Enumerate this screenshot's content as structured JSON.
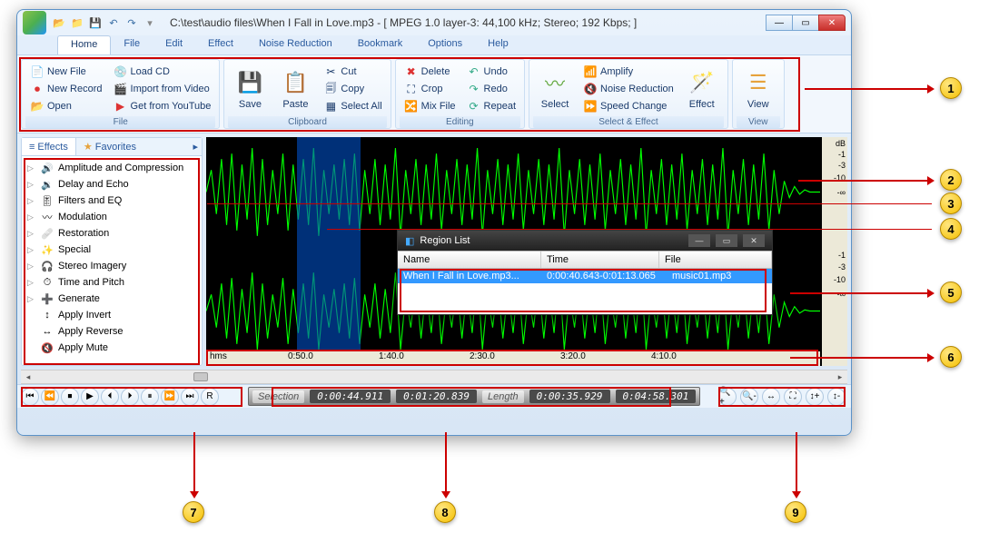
{
  "window": {
    "title": "C:\\test\\audio files\\When I Fall in Love.mp3 - [ MPEG 1.0 layer-3: 44,100 kHz; Stereo; 192 Kbps;  ]"
  },
  "menu": {
    "items": [
      "Home",
      "File",
      "Edit",
      "Effect",
      "Noise Reduction",
      "Bookmark",
      "Options",
      "Help"
    ],
    "active": 0
  },
  "ribbon": {
    "file": {
      "label": "File",
      "newfile": "New File",
      "newrecord": "New Record",
      "open": "Open",
      "loadcd": "Load CD",
      "importvideo": "Import from Video",
      "youtube": "Get from YouTube"
    },
    "save": "Save",
    "paste": "Paste",
    "clipboard": {
      "label": "Clipboard",
      "cut": "Cut",
      "copy": "Copy",
      "selectall": "Select All"
    },
    "editing": {
      "label": "Editing",
      "delete": "Delete",
      "crop": "Crop",
      "mixfile": "Mix File",
      "undo": "Undo",
      "redo": "Redo",
      "repeat": "Repeat"
    },
    "select": "Select",
    "selecteffect": {
      "label": "Select & Effect",
      "amplify": "Amplify",
      "noisered": "Noise Reduction",
      "speedchange": "Speed Change"
    },
    "effect": "Effect",
    "view": "View",
    "viewlabel": "View"
  },
  "side": {
    "tab_effects": "Effects",
    "tab_favorites": "Favorites",
    "items": [
      "Amplitude and Compression",
      "Delay and Echo",
      "Filters and EQ",
      "Modulation",
      "Restoration",
      "Special",
      "Stereo Imagery",
      "Time and Pitch",
      "Generate",
      "Apply Invert",
      "Apply Reverse",
      "Apply Mute"
    ]
  },
  "dbscale": {
    "label": "dB",
    "marks": [
      "-1",
      "-3",
      "-10",
      "-∞",
      "-10",
      "-3",
      "-1"
    ]
  },
  "timeline": {
    "unit": "hms",
    "marks": [
      "0:50.0",
      "1:40.0",
      "2:30.0",
      "3:20.0",
      "4:10.0"
    ]
  },
  "region": {
    "title": "Region List",
    "col_name": "Name",
    "col_time": "Time",
    "col_file": "File",
    "row_name": "When I Fall in Love.mp3...",
    "row_time": "0:00:40.643-0:01:13.065",
    "row_file": "music01.mp3"
  },
  "status": {
    "sel_label": "Selection",
    "sel_start": "0:00:44.911",
    "sel_end": "0:01:20.839",
    "len_label": "Length",
    "len_val": "0:00:35.929",
    "total": "0:04:58.301"
  },
  "callouts": [
    "1",
    "2",
    "3",
    "4",
    "5",
    "6",
    "7",
    "8",
    "9"
  ]
}
